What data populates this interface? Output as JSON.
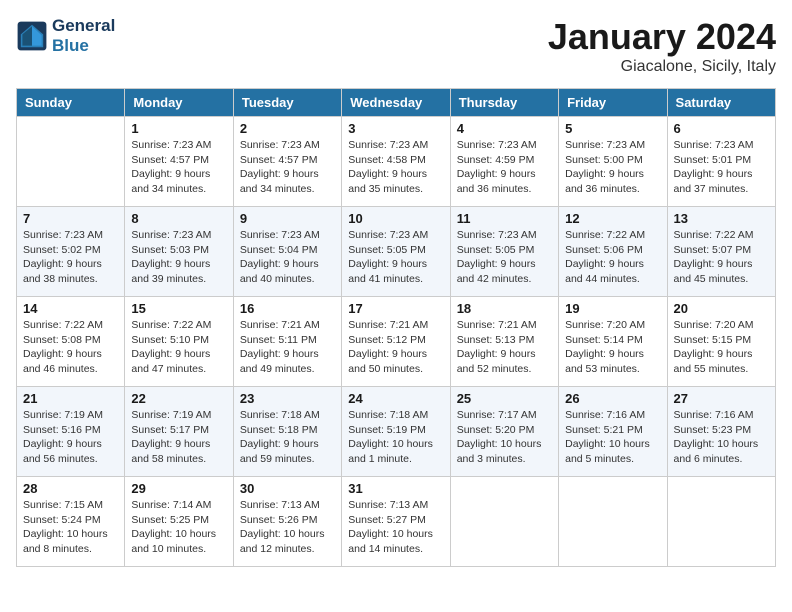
{
  "header": {
    "logo_line1": "General",
    "logo_line2": "Blue",
    "month": "January 2024",
    "location": "Giacalone, Sicily, Italy"
  },
  "weekdays": [
    "Sunday",
    "Monday",
    "Tuesday",
    "Wednesday",
    "Thursday",
    "Friday",
    "Saturday"
  ],
  "weeks": [
    [
      {
        "day": "",
        "info": ""
      },
      {
        "day": "1",
        "info": "Sunrise: 7:23 AM\nSunset: 4:57 PM\nDaylight: 9 hours\nand 34 minutes."
      },
      {
        "day": "2",
        "info": "Sunrise: 7:23 AM\nSunset: 4:57 PM\nDaylight: 9 hours\nand 34 minutes."
      },
      {
        "day": "3",
        "info": "Sunrise: 7:23 AM\nSunset: 4:58 PM\nDaylight: 9 hours\nand 35 minutes."
      },
      {
        "day": "4",
        "info": "Sunrise: 7:23 AM\nSunset: 4:59 PM\nDaylight: 9 hours\nand 36 minutes."
      },
      {
        "day": "5",
        "info": "Sunrise: 7:23 AM\nSunset: 5:00 PM\nDaylight: 9 hours\nand 36 minutes."
      },
      {
        "day": "6",
        "info": "Sunrise: 7:23 AM\nSunset: 5:01 PM\nDaylight: 9 hours\nand 37 minutes."
      }
    ],
    [
      {
        "day": "7",
        "info": "Sunrise: 7:23 AM\nSunset: 5:02 PM\nDaylight: 9 hours\nand 38 minutes."
      },
      {
        "day": "8",
        "info": "Sunrise: 7:23 AM\nSunset: 5:03 PM\nDaylight: 9 hours\nand 39 minutes."
      },
      {
        "day": "9",
        "info": "Sunrise: 7:23 AM\nSunset: 5:04 PM\nDaylight: 9 hours\nand 40 minutes."
      },
      {
        "day": "10",
        "info": "Sunrise: 7:23 AM\nSunset: 5:05 PM\nDaylight: 9 hours\nand 41 minutes."
      },
      {
        "day": "11",
        "info": "Sunrise: 7:23 AM\nSunset: 5:05 PM\nDaylight: 9 hours\nand 42 minutes."
      },
      {
        "day": "12",
        "info": "Sunrise: 7:22 AM\nSunset: 5:06 PM\nDaylight: 9 hours\nand 44 minutes."
      },
      {
        "day": "13",
        "info": "Sunrise: 7:22 AM\nSunset: 5:07 PM\nDaylight: 9 hours\nand 45 minutes."
      }
    ],
    [
      {
        "day": "14",
        "info": "Sunrise: 7:22 AM\nSunset: 5:08 PM\nDaylight: 9 hours\nand 46 minutes."
      },
      {
        "day": "15",
        "info": "Sunrise: 7:22 AM\nSunset: 5:10 PM\nDaylight: 9 hours\nand 47 minutes."
      },
      {
        "day": "16",
        "info": "Sunrise: 7:21 AM\nSunset: 5:11 PM\nDaylight: 9 hours\nand 49 minutes."
      },
      {
        "day": "17",
        "info": "Sunrise: 7:21 AM\nSunset: 5:12 PM\nDaylight: 9 hours\nand 50 minutes."
      },
      {
        "day": "18",
        "info": "Sunrise: 7:21 AM\nSunset: 5:13 PM\nDaylight: 9 hours\nand 52 minutes."
      },
      {
        "day": "19",
        "info": "Sunrise: 7:20 AM\nSunset: 5:14 PM\nDaylight: 9 hours\nand 53 minutes."
      },
      {
        "day": "20",
        "info": "Sunrise: 7:20 AM\nSunset: 5:15 PM\nDaylight: 9 hours\nand 55 minutes."
      }
    ],
    [
      {
        "day": "21",
        "info": "Sunrise: 7:19 AM\nSunset: 5:16 PM\nDaylight: 9 hours\nand 56 minutes."
      },
      {
        "day": "22",
        "info": "Sunrise: 7:19 AM\nSunset: 5:17 PM\nDaylight: 9 hours\nand 58 minutes."
      },
      {
        "day": "23",
        "info": "Sunrise: 7:18 AM\nSunset: 5:18 PM\nDaylight: 9 hours\nand 59 minutes."
      },
      {
        "day": "24",
        "info": "Sunrise: 7:18 AM\nSunset: 5:19 PM\nDaylight: 10 hours\nand 1 minute."
      },
      {
        "day": "25",
        "info": "Sunrise: 7:17 AM\nSunset: 5:20 PM\nDaylight: 10 hours\nand 3 minutes."
      },
      {
        "day": "26",
        "info": "Sunrise: 7:16 AM\nSunset: 5:21 PM\nDaylight: 10 hours\nand 5 minutes."
      },
      {
        "day": "27",
        "info": "Sunrise: 7:16 AM\nSunset: 5:23 PM\nDaylight: 10 hours\nand 6 minutes."
      }
    ],
    [
      {
        "day": "28",
        "info": "Sunrise: 7:15 AM\nSunset: 5:24 PM\nDaylight: 10 hours\nand 8 minutes."
      },
      {
        "day": "29",
        "info": "Sunrise: 7:14 AM\nSunset: 5:25 PM\nDaylight: 10 hours\nand 10 minutes."
      },
      {
        "day": "30",
        "info": "Sunrise: 7:13 AM\nSunset: 5:26 PM\nDaylight: 10 hours\nand 12 minutes."
      },
      {
        "day": "31",
        "info": "Sunrise: 7:13 AM\nSunset: 5:27 PM\nDaylight: 10 hours\nand 14 minutes."
      },
      {
        "day": "",
        "info": ""
      },
      {
        "day": "",
        "info": ""
      },
      {
        "day": "",
        "info": ""
      }
    ]
  ]
}
